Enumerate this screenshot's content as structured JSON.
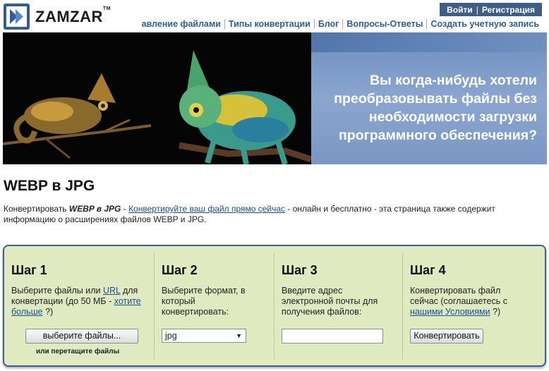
{
  "header": {
    "logo_text": "ZAMZAR",
    "logo_tm": "TM",
    "login_label": "Войти",
    "login_sep": "|",
    "register_label": "Регистрация",
    "nav": [
      {
        "label": "авление файлами"
      },
      {
        "label": "Типы конвертации"
      },
      {
        "label": "Блог"
      },
      {
        "label": "Вопросы-Ответы"
      },
      {
        "label": "Создать учетную запись"
      }
    ]
  },
  "banner": {
    "text": "Вы когда-нибудь хотели преобразовывать файлы без необходимости загрузки программного обеспечения?"
  },
  "page": {
    "title": "WEBP в JPG",
    "intro_prefix": "Конвертировать ",
    "intro_bold": "WEBP в JPG",
    "intro_dash": " - ",
    "intro_link": "Конвертируйте ваш файл прямо сейчас",
    "intro_suffix": " - онлайн и бесплатно - эта страница также содержит информацию о расширениях файлов WEBP и JPG."
  },
  "steps": [
    {
      "title": "Шаг 1",
      "text_a": "Выберите файлы или ",
      "link_a": "URL",
      "text_b": " для конвертации (до 50 МБ - ",
      "link_b": "хотите больше",
      "text_c": " ?)",
      "button": "выберите файлы...",
      "note": "или перетащите файлы"
    },
    {
      "title": "Шаг 2",
      "text": "Выберите формат, в который конвертировать:",
      "selected": "jpg",
      "arrow": "▼"
    },
    {
      "title": "Шаг 3",
      "text": "Введите адрес электронной почты для получения файлов:",
      "email_value": ""
    },
    {
      "title": "Шаг 4",
      "text_a": "Конвертировать файл сейчас (соглашаетесь с ",
      "link_a": "нашими Условиями",
      "text_b": " ?)",
      "button": "Конвертировать"
    }
  ],
  "colors": {
    "brand_blue": "#3e5e89",
    "link": "#2a5ea0",
    "steps_bg": "#dfeac1",
    "steps_border": "#3f6192"
  }
}
